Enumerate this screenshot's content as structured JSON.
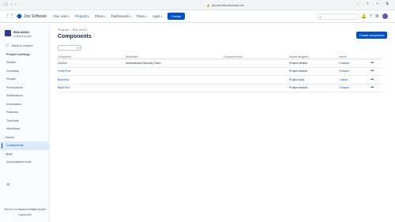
{
  "browser": {
    "url": "jira-ccs.beta.atlassian.net"
  },
  "topnav": {
    "product": "Jira Software",
    "items": [
      {
        "label": "Your work",
        "active": false
      },
      {
        "label": "Projects",
        "active": true
      },
      {
        "label": "Filters",
        "active": false
      },
      {
        "label": "Dashboards",
        "active": false
      },
      {
        "label": "Plans",
        "active": false
      },
      {
        "label": "Apps",
        "active": false
      }
    ],
    "create_label": "Create",
    "search_placeholder": "Search"
  },
  "sidebar": {
    "project_name": "RULA2024",
    "project_type": "Software project",
    "back_label": "Back to project",
    "heading": "Project settings",
    "items": [
      {
        "label": "Details",
        "type": "item"
      },
      {
        "label": "Summary",
        "type": "item"
      },
      {
        "label": "People",
        "type": "item"
      },
      {
        "label": "Permissions",
        "type": "item"
      },
      {
        "label": "Notifications",
        "type": "item"
      },
      {
        "label": "Automation",
        "type": "item"
      },
      {
        "label": "Features",
        "type": "item"
      },
      {
        "label": "Toolchain",
        "type": "item"
      },
      {
        "label": "Workflows",
        "type": "item"
      },
      {
        "label": "Issues",
        "type": "expand"
      },
      {
        "label": "Components",
        "type": "selected"
      },
      {
        "label": "Apps",
        "type": "expand"
      },
      {
        "label": "Development tools",
        "type": "item"
      }
    ],
    "footer_text": "You're in a company-managed project",
    "footer_link": "Learn more"
  },
  "main": {
    "breadcrumb": [
      "Projects",
      "RULA2024"
    ],
    "title": "Components",
    "create_button": "Create component",
    "columns": [
      "Component",
      "Description",
      "Component lead",
      "Default assignee",
      "Issues"
    ],
    "rows": [
      {
        "component": "InfoSec",
        "description": "Informational Security Team",
        "lead": "",
        "assignee": "Project default",
        "issues": "0 issues"
      },
      {
        "component": "Front End",
        "description": "",
        "lead": "",
        "assignee": "Project default",
        "issues": "3 issues"
      },
      {
        "component": "Business",
        "description": "",
        "lead": "",
        "assignee": "Project lead",
        "issues": "1 issue"
      },
      {
        "component": "Back End",
        "description": "",
        "lead": "",
        "assignee": "Project default",
        "issues": "3 issues"
      }
    ]
  },
  "colors": {
    "accent": "#0052cc",
    "selected_bg": "#deebff"
  }
}
